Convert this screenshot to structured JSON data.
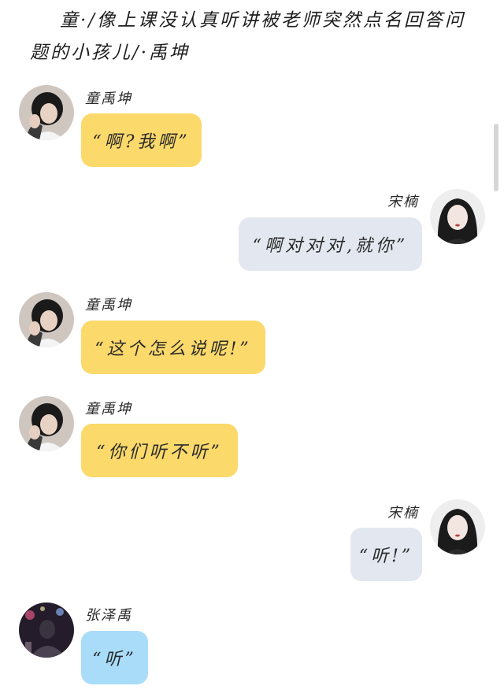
{
  "title": "童·/像上课没认真听讲被老师突然点名回答问题的小孩儿/·禹坤",
  "messages": [
    {
      "sender": "童禹坤",
      "text": "“啊?我啊”",
      "side": "left",
      "color": "#fbd96b",
      "avatar": "boy-avatar"
    },
    {
      "sender": "宋楠",
      "text": "“啊对对对,就你”",
      "side": "right",
      "color": "#e3e8f0",
      "avatar": "girl-avatar"
    },
    {
      "sender": "童禹坤",
      "text": "“这个怎么说呢!”",
      "side": "left",
      "color": "#fbd96b",
      "avatar": "boy-avatar"
    },
    {
      "sender": "童禹坤",
      "text": "“你们听不听”",
      "side": "left",
      "color": "#fbd96b",
      "avatar": "boy-avatar"
    },
    {
      "sender": "宋楠",
      "text": "“听!”",
      "side": "right",
      "color": "#e3e8f0",
      "avatar": "girl-avatar"
    },
    {
      "sender": "张泽禹",
      "text": "“听”",
      "side": "left",
      "color": "#a8dcf9",
      "avatar": "concert-avatar"
    }
  ]
}
